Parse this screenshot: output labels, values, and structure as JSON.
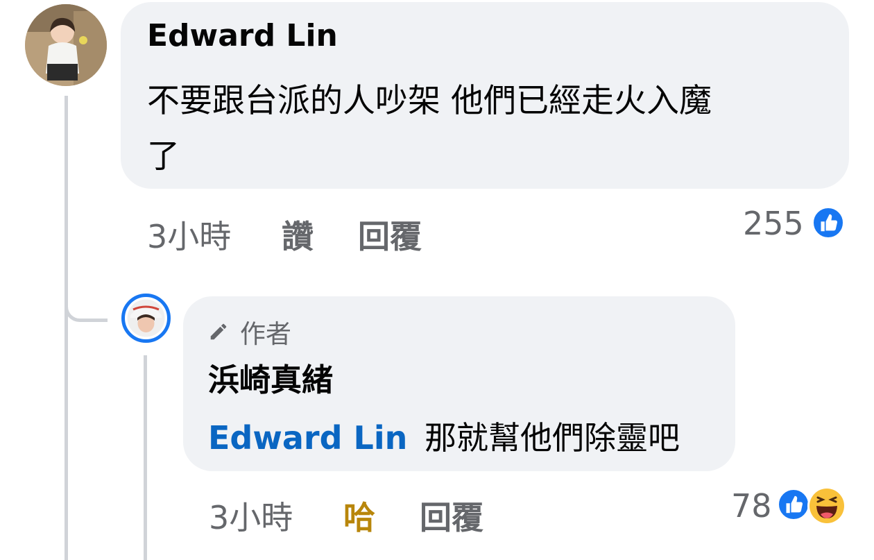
{
  "comment": {
    "author": "Edward Lin",
    "text_line1": "不要跟台派的人吵架 他們已經走火入魔",
    "text_line2": "了",
    "time": "3小時",
    "like_label": "讚",
    "reply_label": "回覆",
    "reaction_count": "255",
    "reaction_icons": [
      "like-icon"
    ]
  },
  "reply": {
    "badge_label": "作者",
    "badge_icon": "pencil-icon",
    "author": "浜崎真緒",
    "mention": "Edward Lin",
    "text": "那就幫他們除靈吧",
    "time": "3小時",
    "reaction_label": "哈",
    "reply_label": "回覆",
    "reaction_count": "78",
    "reaction_icons": [
      "like-icon",
      "haha-icon"
    ]
  },
  "colors": {
    "bubble": "#f0f2f5",
    "mention": "#0a66c2",
    "haha": "#b8860b",
    "like": "#1877f2",
    "meta": "#65676b"
  }
}
